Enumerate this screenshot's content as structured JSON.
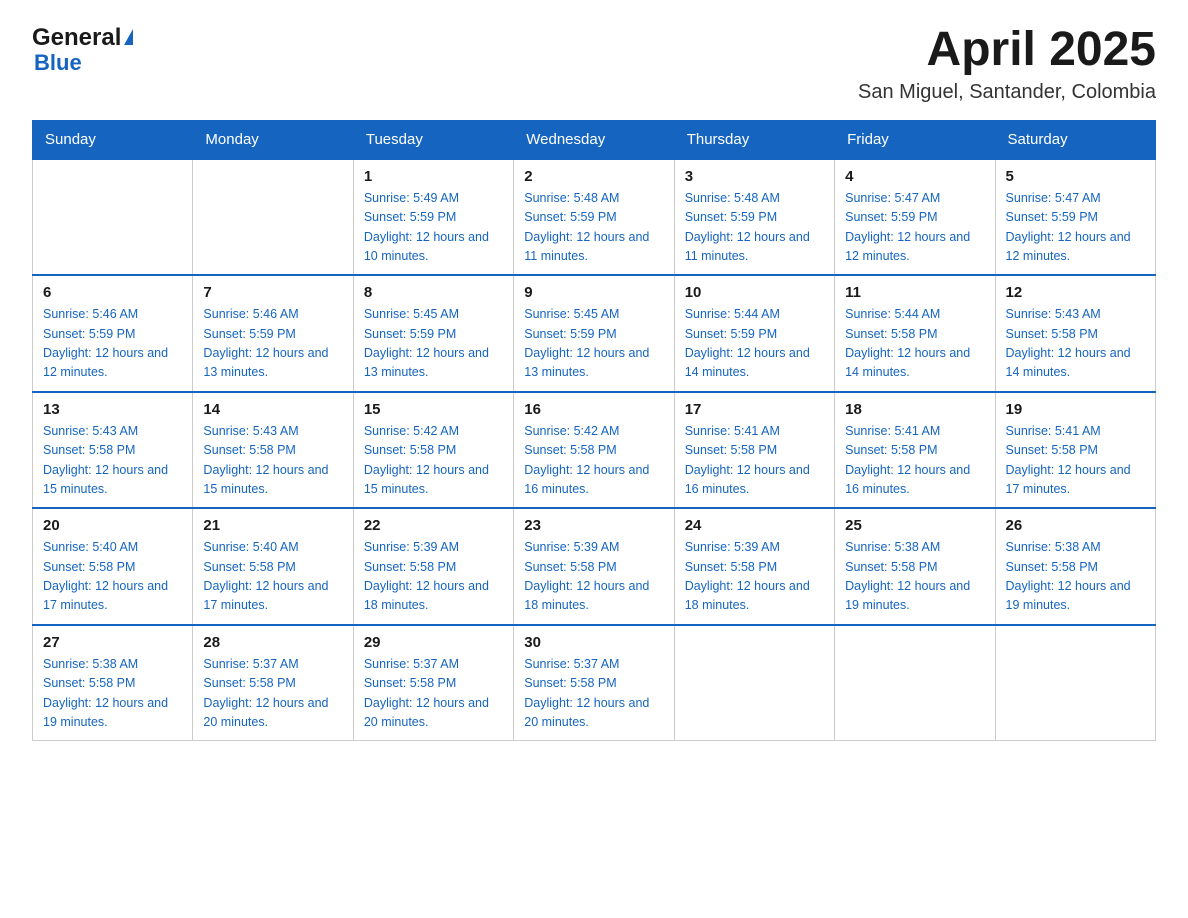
{
  "header": {
    "logo_general": "General",
    "logo_blue": "Blue",
    "month_title": "April 2025",
    "location": "San Miguel, Santander, Colombia"
  },
  "weekdays": [
    "Sunday",
    "Monday",
    "Tuesday",
    "Wednesday",
    "Thursday",
    "Friday",
    "Saturday"
  ],
  "weeks": [
    [
      {
        "day": "",
        "sunrise": "",
        "sunset": "",
        "daylight": ""
      },
      {
        "day": "",
        "sunrise": "",
        "sunset": "",
        "daylight": ""
      },
      {
        "day": "1",
        "sunrise": "Sunrise: 5:49 AM",
        "sunset": "Sunset: 5:59 PM",
        "daylight": "Daylight: 12 hours and 10 minutes."
      },
      {
        "day": "2",
        "sunrise": "Sunrise: 5:48 AM",
        "sunset": "Sunset: 5:59 PM",
        "daylight": "Daylight: 12 hours and 11 minutes."
      },
      {
        "day": "3",
        "sunrise": "Sunrise: 5:48 AM",
        "sunset": "Sunset: 5:59 PM",
        "daylight": "Daylight: 12 hours and 11 minutes."
      },
      {
        "day": "4",
        "sunrise": "Sunrise: 5:47 AM",
        "sunset": "Sunset: 5:59 PM",
        "daylight": "Daylight: 12 hours and 12 minutes."
      },
      {
        "day": "5",
        "sunrise": "Sunrise: 5:47 AM",
        "sunset": "Sunset: 5:59 PM",
        "daylight": "Daylight: 12 hours and 12 minutes."
      }
    ],
    [
      {
        "day": "6",
        "sunrise": "Sunrise: 5:46 AM",
        "sunset": "Sunset: 5:59 PM",
        "daylight": "Daylight: 12 hours and 12 minutes."
      },
      {
        "day": "7",
        "sunrise": "Sunrise: 5:46 AM",
        "sunset": "Sunset: 5:59 PM",
        "daylight": "Daylight: 12 hours and 13 minutes."
      },
      {
        "day": "8",
        "sunrise": "Sunrise: 5:45 AM",
        "sunset": "Sunset: 5:59 PM",
        "daylight": "Daylight: 12 hours and 13 minutes."
      },
      {
        "day": "9",
        "sunrise": "Sunrise: 5:45 AM",
        "sunset": "Sunset: 5:59 PM",
        "daylight": "Daylight: 12 hours and 13 minutes."
      },
      {
        "day": "10",
        "sunrise": "Sunrise: 5:44 AM",
        "sunset": "Sunset: 5:59 PM",
        "daylight": "Daylight: 12 hours and 14 minutes."
      },
      {
        "day": "11",
        "sunrise": "Sunrise: 5:44 AM",
        "sunset": "Sunset: 5:58 PM",
        "daylight": "Daylight: 12 hours and 14 minutes."
      },
      {
        "day": "12",
        "sunrise": "Sunrise: 5:43 AM",
        "sunset": "Sunset: 5:58 PM",
        "daylight": "Daylight: 12 hours and 14 minutes."
      }
    ],
    [
      {
        "day": "13",
        "sunrise": "Sunrise: 5:43 AM",
        "sunset": "Sunset: 5:58 PM",
        "daylight": "Daylight: 12 hours and 15 minutes."
      },
      {
        "day": "14",
        "sunrise": "Sunrise: 5:43 AM",
        "sunset": "Sunset: 5:58 PM",
        "daylight": "Daylight: 12 hours and 15 minutes."
      },
      {
        "day": "15",
        "sunrise": "Sunrise: 5:42 AM",
        "sunset": "Sunset: 5:58 PM",
        "daylight": "Daylight: 12 hours and 15 minutes."
      },
      {
        "day": "16",
        "sunrise": "Sunrise: 5:42 AM",
        "sunset": "Sunset: 5:58 PM",
        "daylight": "Daylight: 12 hours and 16 minutes."
      },
      {
        "day": "17",
        "sunrise": "Sunrise: 5:41 AM",
        "sunset": "Sunset: 5:58 PM",
        "daylight": "Daylight: 12 hours and 16 minutes."
      },
      {
        "day": "18",
        "sunrise": "Sunrise: 5:41 AM",
        "sunset": "Sunset: 5:58 PM",
        "daylight": "Daylight: 12 hours and 16 minutes."
      },
      {
        "day": "19",
        "sunrise": "Sunrise: 5:41 AM",
        "sunset": "Sunset: 5:58 PM",
        "daylight": "Daylight: 12 hours and 17 minutes."
      }
    ],
    [
      {
        "day": "20",
        "sunrise": "Sunrise: 5:40 AM",
        "sunset": "Sunset: 5:58 PM",
        "daylight": "Daylight: 12 hours and 17 minutes."
      },
      {
        "day": "21",
        "sunrise": "Sunrise: 5:40 AM",
        "sunset": "Sunset: 5:58 PM",
        "daylight": "Daylight: 12 hours and 17 minutes."
      },
      {
        "day": "22",
        "sunrise": "Sunrise: 5:39 AM",
        "sunset": "Sunset: 5:58 PM",
        "daylight": "Daylight: 12 hours and 18 minutes."
      },
      {
        "day": "23",
        "sunrise": "Sunrise: 5:39 AM",
        "sunset": "Sunset: 5:58 PM",
        "daylight": "Daylight: 12 hours and 18 minutes."
      },
      {
        "day": "24",
        "sunrise": "Sunrise: 5:39 AM",
        "sunset": "Sunset: 5:58 PM",
        "daylight": "Daylight: 12 hours and 18 minutes."
      },
      {
        "day": "25",
        "sunrise": "Sunrise: 5:38 AM",
        "sunset": "Sunset: 5:58 PM",
        "daylight": "Daylight: 12 hours and 19 minutes."
      },
      {
        "day": "26",
        "sunrise": "Sunrise: 5:38 AM",
        "sunset": "Sunset: 5:58 PM",
        "daylight": "Daylight: 12 hours and 19 minutes."
      }
    ],
    [
      {
        "day": "27",
        "sunrise": "Sunrise: 5:38 AM",
        "sunset": "Sunset: 5:58 PM",
        "daylight": "Daylight: 12 hours and 19 minutes."
      },
      {
        "day": "28",
        "sunrise": "Sunrise: 5:37 AM",
        "sunset": "Sunset: 5:58 PM",
        "daylight": "Daylight: 12 hours and 20 minutes."
      },
      {
        "day": "29",
        "sunrise": "Sunrise: 5:37 AM",
        "sunset": "Sunset: 5:58 PM",
        "daylight": "Daylight: 12 hours and 20 minutes."
      },
      {
        "day": "30",
        "sunrise": "Sunrise: 5:37 AM",
        "sunset": "Sunset: 5:58 PM",
        "daylight": "Daylight: 12 hours and 20 minutes."
      },
      {
        "day": "",
        "sunrise": "",
        "sunset": "",
        "daylight": ""
      },
      {
        "day": "",
        "sunrise": "",
        "sunset": "",
        "daylight": ""
      },
      {
        "day": "",
        "sunrise": "",
        "sunset": "",
        "daylight": ""
      }
    ]
  ]
}
